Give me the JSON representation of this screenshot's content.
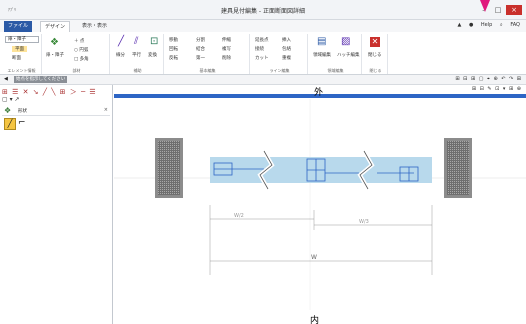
{
  "window": {
    "title": "建具見付編集 - 正面断面図詳細",
    "app_icon_text": "ｱﾌﾟﾘ",
    "controls": {
      "minimize": "–",
      "maximize": "□",
      "close": "×"
    }
  },
  "tabs": {
    "file": "ファイル",
    "design": "デザイン",
    "view": "表示・表示"
  },
  "help": {
    "expand": "▲",
    "help": "Help",
    "faq": "FAQ"
  },
  "ribbon": {
    "group1": {
      "combo": "扉・障子",
      "btn1": "平面",
      "btn2": "断面",
      "label": "エレメント情報"
    },
    "group2": {
      "btn": "扉・障子",
      "item1": "＋ 点",
      "item2": "○ 円弧",
      "item3": "□ 多角",
      "label": "部材"
    },
    "group3": {
      "item1": "線分",
      "item2": "平行",
      "item3": "変換",
      "label": "補助"
    },
    "group4": {
      "item1": "移動",
      "item2": "回転",
      "item3": "反転",
      "item4": "分割",
      "item5": "結合",
      "item6": "第一",
      "item7": "伸縮",
      "item8": "複写",
      "item9": "削除",
      "label": "基本編集"
    },
    "group5": {
      "item1": "延長点",
      "item2": "接続",
      "item3": "カット",
      "item4": "挿入",
      "item5": "包絡",
      "item6": "重複",
      "label": "ライン編集"
    },
    "group6": {
      "item1": "領域編集",
      "item2": "ハッチ編集",
      "label": "領域編集"
    },
    "group7": {
      "item1": "閉じる",
      "label": "閉じる"
    }
  },
  "qa": {
    "status": "始点を指示してください",
    "tools_right": "⊞ ⊟ ⊞ ▢ ⌖ ⊕ ↶ ↷ ⊞"
  },
  "left_panel": {
    "header": "形状",
    "tools": "⊞ ☰ ✕ ↘ ╱ ╲ ⊞ ＞ ─ ☰",
    "tools2": "▢ ▾ ↗"
  },
  "canvas": {
    "label_top": "外",
    "label_bottom": "内",
    "dim_w": "W",
    "dim_w2": "W/2",
    "dim_w3": "W/3",
    "colors": {
      "frame": "#2d65c5",
      "band": "#b8d9ec",
      "wall": "#808080"
    }
  }
}
